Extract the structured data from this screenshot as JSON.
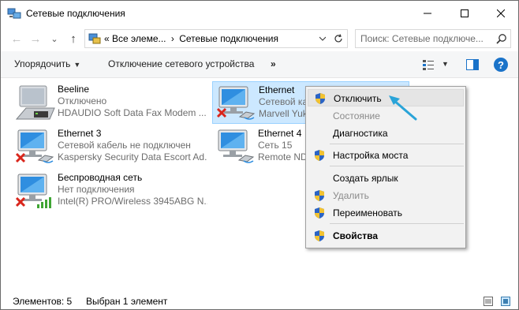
{
  "window": {
    "title": "Сетевые подключения"
  },
  "nav": {
    "back_glyph": "←",
    "forward_glyph": "→",
    "recent_glyph": "⌄",
    "up_glyph": "↑",
    "address_prefix": "«",
    "address_path": [
      "Все элеме...",
      "Сетевые подключения"
    ],
    "address_separator": "›",
    "search_placeholder": "Поиск: Сетевые подключе..."
  },
  "commandbar": {
    "organize_label": "Упорядочить",
    "disable_device_label": "Отключение сетевого устройства",
    "more_label": "»",
    "help_label": "?"
  },
  "connections": [
    {
      "name": "Beeline",
      "status": "Отключено",
      "device": "HDAUDIO Soft Data Fax Modem ...",
      "icon": "modem-icon",
      "error": false,
      "selected": false
    },
    {
      "name": "Ethernet",
      "status": "Сетевой каб...",
      "device": "Marvell Yuk...",
      "icon": "ethernet-icon",
      "error": true,
      "selected": true
    },
    {
      "name": "Ethernet 3",
      "status": "Сетевой кабель не подключен",
      "device": "Kaspersky Security Data Escort Ad...",
      "icon": "ethernet-icon",
      "error": true,
      "selected": false
    },
    {
      "name": "Ethernet 4",
      "status": "Сеть  15",
      "device": "Remote ND...",
      "icon": "ethernet-icon",
      "error": false,
      "selected": false
    },
    {
      "name": "Беспроводная сеть",
      "status": "Нет подключения",
      "device": "Intel(R) PRO/Wireless 3945ABG N...",
      "icon": "wifi-icon",
      "error": true,
      "selected": false
    }
  ],
  "context_menu": {
    "items": [
      {
        "label": "Отключить",
        "shield": true,
        "disabled": false,
        "bold": false,
        "highlighted": true
      },
      {
        "label": "Состояние",
        "shield": false,
        "disabled": true,
        "bold": false,
        "highlighted": false
      },
      {
        "label": "Диагностика",
        "shield": false,
        "disabled": false,
        "bold": false,
        "highlighted": false
      },
      {
        "label": "Настройка моста",
        "shield": true,
        "disabled": false,
        "bold": false,
        "highlighted": false
      },
      {
        "label": "Создать ярлык",
        "shield": false,
        "disabled": false,
        "bold": false,
        "highlighted": false
      },
      {
        "label": "Удалить",
        "shield": true,
        "disabled": true,
        "bold": false,
        "highlighted": false
      },
      {
        "label": "Переименовать",
        "shield": true,
        "disabled": false,
        "bold": false,
        "highlighted": false
      },
      {
        "label": "Свойства",
        "shield": true,
        "disabled": false,
        "bold": true,
        "highlighted": false
      }
    ]
  },
  "statusbar": {
    "count": "Элементов: 5",
    "selection": "Выбран 1 элемент"
  },
  "colors": {
    "selection_bg": "#cce8ff",
    "selection_border": "#99d1ff",
    "accent_blue": "#1a73c9",
    "pointer": "#2aa4d8",
    "error_red": "#d9261c"
  }
}
